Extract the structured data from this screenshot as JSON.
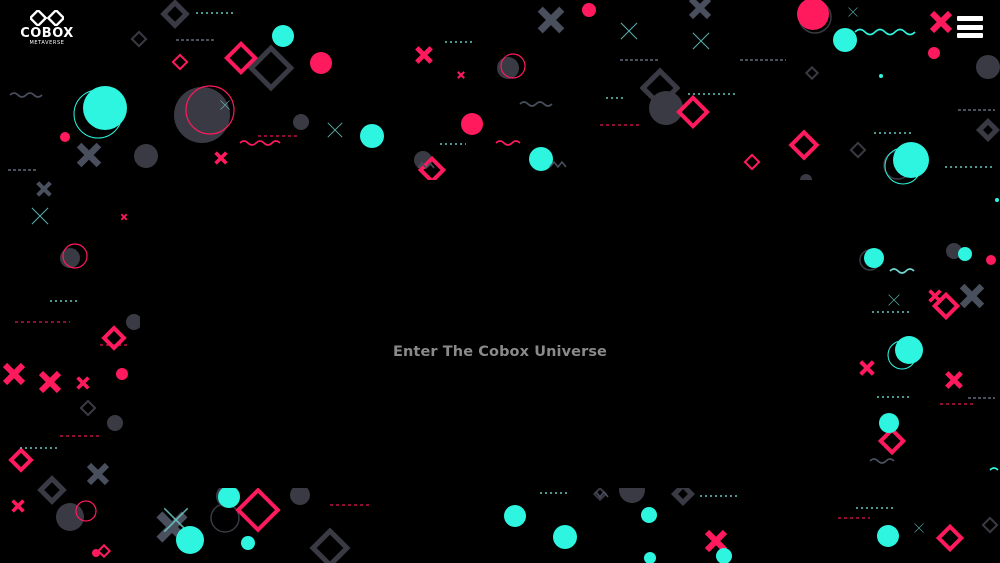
{
  "brand": {
    "name": "COBOX",
    "tagline": "METAVERSE",
    "logo_icon": "infinity-knot-icon"
  },
  "header": {
    "menu_icon": "hamburger-menu-icon"
  },
  "hero": {
    "enter_label": "Enter The Cobox Universe"
  },
  "colors": {
    "background": "#000000",
    "accent_pink": "#ff1a5e",
    "accent_cyan": "#2ef5e0",
    "shape_gray": "#3c3c46",
    "text_gray": "#8a8a8a"
  }
}
